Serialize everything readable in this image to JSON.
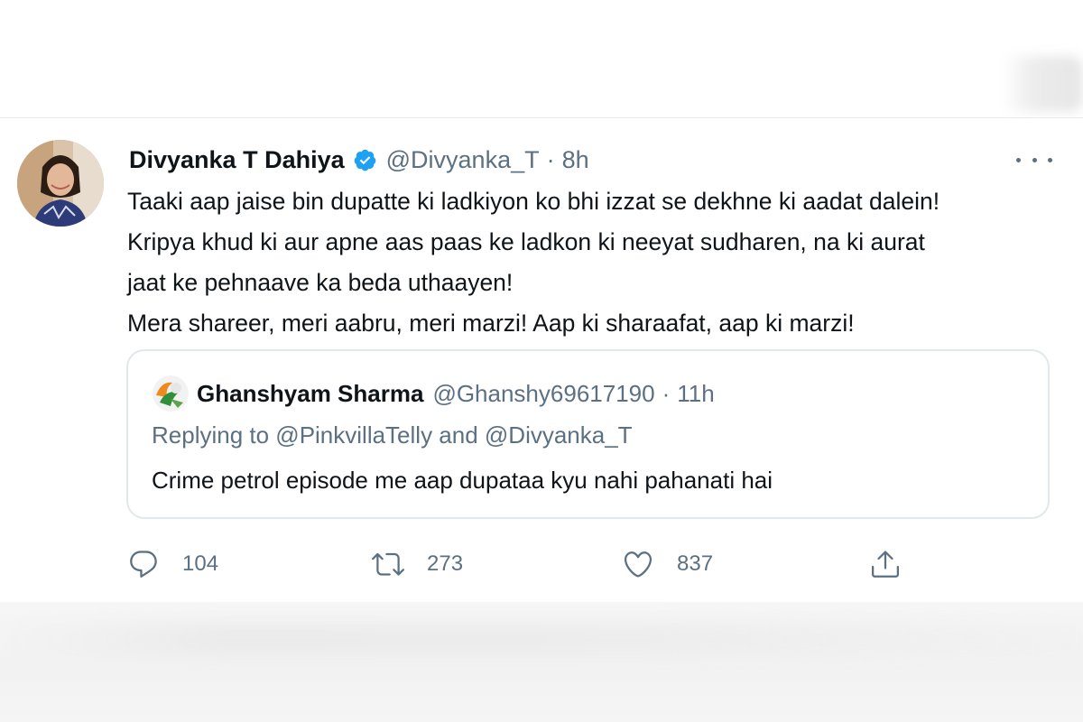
{
  "tweet": {
    "display_name": "Divyanka T Dahiya",
    "handle": "@Divyanka_T",
    "separator": "·",
    "time": "8h",
    "text_lines": [
      "Taaki aap jaise bin dupatte ki ladkiyon ko bhi izzat se dekhne ki aadat dalein!",
      "Kripya khud ki aur apne aas paas ke ladkon ki neeyat sudharen, na ki aurat",
      "jaat ke pehnaave ka beda uthaayen!",
      "Mera shareer, meri aabru, meri marzi! Aap ki sharaafat, aap ki marzi!"
    ],
    "icons": {
      "verified": "verified-badge-icon",
      "more": "more-options-icon"
    },
    "colors": {
      "verified": "#1da1f2",
      "muted": "#5b7083",
      "text": "#0f1419",
      "border": "#e1e8ed"
    }
  },
  "quote": {
    "display_name": "Ghanshyam Sharma",
    "handle": "@Ghanshy69617190",
    "separator": "·",
    "time": "11h",
    "replying_to": "Replying to @PinkvillaTelly and @Divyanka_T",
    "text": "Crime petrol episode me aap dupataa kyu nahi pahanati hai"
  },
  "actions": {
    "reply": {
      "icon": "reply-icon",
      "count": "104"
    },
    "retweet": {
      "icon": "retweet-icon",
      "count": "273"
    },
    "like": {
      "icon": "like-icon",
      "count": "837"
    },
    "share": {
      "icon": "share-icon"
    }
  }
}
